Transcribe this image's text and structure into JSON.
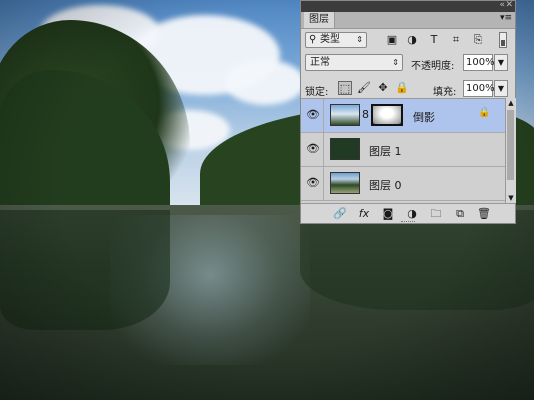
{
  "panel": {
    "tab_label": "图层",
    "collapse_icon": "double-chevron-icon",
    "close_icon": "close-icon",
    "menu_icon": "panel-menu-icon"
  },
  "filter": {
    "kind_label": "类型",
    "icons": [
      "pixel-layer-filter-icon",
      "adjustment-filter-icon",
      "type-filter-icon",
      "shape-filter-icon",
      "smart-object-filter-icon"
    ]
  },
  "blend": {
    "mode": "正常",
    "opacity_label": "不透明度:",
    "opacity_value": "100%"
  },
  "lock": {
    "label": "锁定:",
    "fill_label": "填充:",
    "fill_value": "100%"
  },
  "layers": [
    {
      "name": "倒影",
      "selected": true,
      "has_mask": true,
      "locked_icon": "lock-icon"
    },
    {
      "name": "图层 1",
      "selected": false,
      "has_mask": false
    },
    {
      "name": "图层 0",
      "selected": false,
      "has_mask": false
    }
  ],
  "bottom_icons": [
    "link-layers-icon",
    "fx-icon",
    "add-mask-icon",
    "adjustment-layer-icon",
    "new-group-icon",
    "new-layer-icon",
    "delete-icon"
  ],
  "glyphs": {
    "fx": "fx",
    "type_filter": "T",
    "double_chevron": "«",
    "close": "✕",
    "menu": "▾≡",
    "magnifier": "⚲",
    "arrow_updown": "⇕",
    "arrow_down": "▼",
    "arrow_up": "▲",
    "eye": "👁",
    "link": "🔗",
    "chain": "8",
    "brush": "🖌",
    "move": "✥",
    "lock": "🔒",
    "checker": "⬚",
    "grid_img": "▣",
    "circle_half": "◑",
    "shape": "⌗",
    "smart": "⎘",
    "mask": "◙",
    "folder": "🗀",
    "new_layer": "⧉",
    "trash": "🗑"
  }
}
